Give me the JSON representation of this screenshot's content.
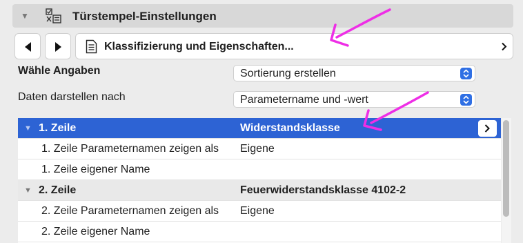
{
  "header": {
    "title": "Türstempel-Einstellungen"
  },
  "nav": {
    "page_label": "Klassifizierung und Eigenschaften..."
  },
  "form": {
    "select_data_label": "Wähle Angaben",
    "select_data_value": "Sortierung erstellen",
    "display_by_label": "Daten darstellen nach",
    "display_by_value": "Parametername und -wert"
  },
  "table": {
    "rows": [
      {
        "label": "1. Zeile",
        "value": "Widerstandsklasse",
        "type": "group",
        "selected": true
      },
      {
        "label": "1. Zeile Parameternamen zeigen als",
        "value": "Eigene",
        "type": "child"
      },
      {
        "label": "1. Zeile eigener Name",
        "value": "",
        "type": "child"
      },
      {
        "label": "2. Zeile",
        "value": "Feuerwiderstandsklasse 4102-2",
        "type": "group",
        "selected": false
      },
      {
        "label": "2. Zeile Parameternamen zeigen als",
        "value": "Eigene",
        "type": "child"
      },
      {
        "label": "2. Zeile eigener Name",
        "value": "",
        "type": "child"
      }
    ]
  },
  "colors": {
    "accent": "#2f6fe4",
    "selection": "#2d63d4",
    "annotation": "#ee2ee6"
  },
  "icons": [
    "collapse-triangle-icon",
    "settings-list-icon",
    "arrow-left-icon",
    "arrow-right-icon",
    "document-icon",
    "chevron-right-icon",
    "updown-stepper-icon"
  ]
}
